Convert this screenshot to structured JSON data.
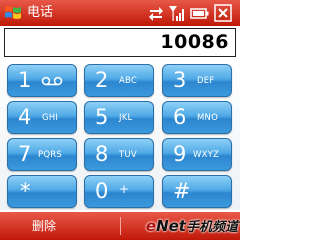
{
  "titlebar": {
    "title": "电话",
    "icons": [
      "windows-start-icon",
      "sync-arrows-icon",
      "signal-strength-icon",
      "battery-icon",
      "close-icon"
    ]
  },
  "display": {
    "number": "10086"
  },
  "keypad": {
    "keys": [
      {
        "digit": "1",
        "letters": "",
        "icon": "voicemail-icon"
      },
      {
        "digit": "2",
        "letters": "ABC"
      },
      {
        "digit": "3",
        "letters": "DEF"
      },
      {
        "digit": "4",
        "letters": "GHI"
      },
      {
        "digit": "5",
        "letters": "JKL"
      },
      {
        "digit": "6",
        "letters": "MNO"
      },
      {
        "digit": "7",
        "letters": "PQRS"
      },
      {
        "digit": "8",
        "letters": "TUV"
      },
      {
        "digit": "9",
        "letters": "WXYZ"
      },
      {
        "digit": "*",
        "letters": ""
      },
      {
        "digit": "0",
        "letters": "+"
      },
      {
        "digit": "#",
        "letters": ""
      }
    ]
  },
  "softbar": {
    "left_label": "删除"
  },
  "watermark": {
    "brand_e": "e",
    "brand_rest": "Net",
    "suffix": "手机频道"
  },
  "colors": {
    "titlebar": "#d03020",
    "key_blue": "#3d9ade",
    "key_text": "#ffffff"
  }
}
